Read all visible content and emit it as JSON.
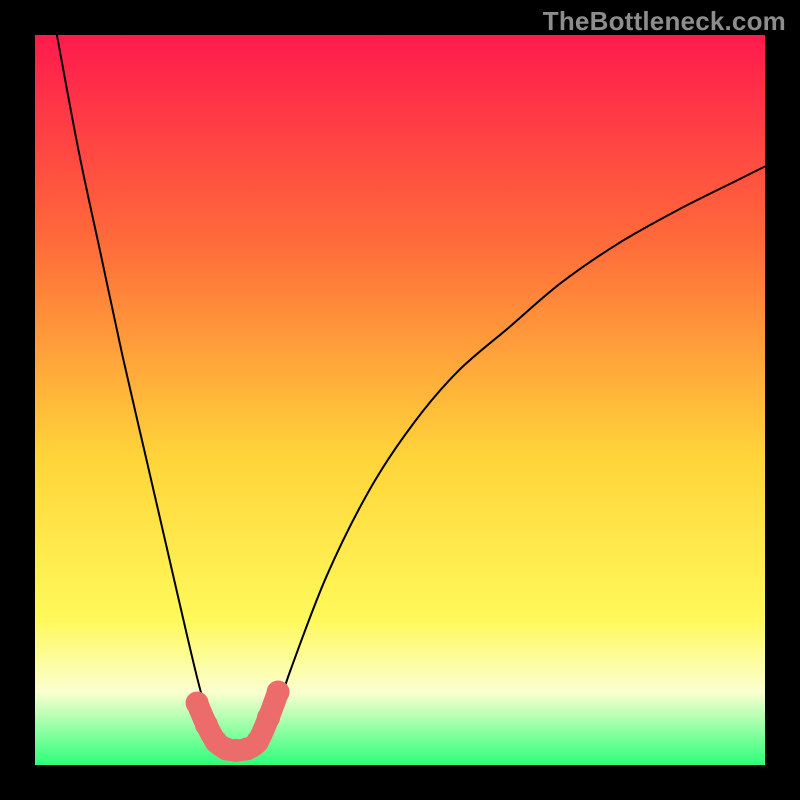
{
  "watermark": "TheBottleneck.com",
  "chart_data": {
    "type": "line",
    "title": "",
    "xlabel": "",
    "ylabel": "",
    "xlim": [
      0,
      1
    ],
    "ylim": [
      0,
      1
    ],
    "background_gradient": {
      "top": "#ff1a4d",
      "upper_mid": "#ff6a3a",
      "mid": "#ffd53a",
      "lower_mid": "#fff95a",
      "band": "#fbffd0",
      "bottom": "#2dff7a"
    },
    "series": [
      {
        "name": "bottleneck-curve",
        "color": "#000000",
        "x": [
          0.03,
          0.06,
          0.09,
          0.12,
          0.15,
          0.18,
          0.21,
          0.23,
          0.25,
          0.27,
          0.29,
          0.31,
          0.33,
          0.35,
          0.4,
          0.46,
          0.52,
          0.58,
          0.65,
          0.72,
          0.8,
          0.88,
          0.96,
          1.0
        ],
        "values": [
          1.0,
          0.84,
          0.7,
          0.56,
          0.43,
          0.3,
          0.17,
          0.09,
          0.035,
          0.02,
          0.02,
          0.03,
          0.07,
          0.13,
          0.26,
          0.38,
          0.47,
          0.54,
          0.6,
          0.66,
          0.715,
          0.76,
          0.8,
          0.82
        ]
      }
    ],
    "highlight_segment": {
      "name": "bottom-highlight",
      "color": "#ec6b6b",
      "x": [
        0.222,
        0.235,
        0.248,
        0.262,
        0.275,
        0.29,
        0.305,
        0.32,
        0.333
      ],
      "values": [
        0.085,
        0.055,
        0.032,
        0.022,
        0.02,
        0.022,
        0.032,
        0.065,
        0.1
      ]
    }
  }
}
